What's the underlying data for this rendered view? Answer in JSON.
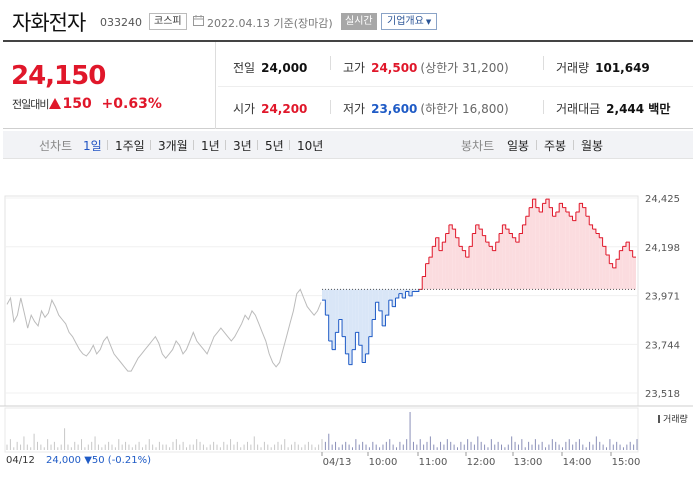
{
  "header": {
    "stock_name": "자화전자",
    "stock_code": "033240",
    "market": "코스피",
    "date": "2022.04.13  기준(장마감)",
    "realtime_label": "실시간",
    "company_label": "기업개요"
  },
  "summary": {
    "current_price": "24,150",
    "change_label": "전일대비",
    "change_value": "150",
    "change_pct": "+0.63%",
    "prev_close": {
      "label": "전일",
      "value": "24,000"
    },
    "high": {
      "label": "고가",
      "value": "24,500",
      "sub": "(상한가 31,200)"
    },
    "volume": {
      "label": "거래량",
      "value": "101,649"
    },
    "open": {
      "label": "시가",
      "value": "24,200"
    },
    "low": {
      "label": "저가",
      "value": "23,600",
      "sub": "(하한가 16,800)"
    },
    "amount": {
      "label": "거래대금",
      "value": "2,444 백만"
    }
  },
  "toolbar": {
    "line_label": "선차트",
    "line_periods": [
      "1일",
      "1주일",
      "3개월",
      "1년",
      "3년",
      "5년",
      "10년"
    ],
    "active_period": "1일",
    "candle_label": "봉차트",
    "candle_periods": [
      "일봉",
      "주봉",
      "월봉"
    ]
  },
  "chart_data": {
    "type": "line",
    "y_ticks": [
      "24,425",
      "24,198",
      "23,971",
      "23,744",
      "23,518"
    ],
    "ylim": [
      23518,
      24425
    ],
    "reference_price": 24000,
    "x_ticks": [
      "04/13",
      "10:00",
      "11:00",
      "12:00",
      "13:00",
      "14:00",
      "15:00"
    ],
    "prev_day_tick": "04/12",
    "volume_label": "거래량",
    "colors": {
      "up": "#e0172a",
      "down": "#1f5bc6",
      "prev": "#bbbbbb",
      "up_fill": "#fbdcdf",
      "down_fill": "#d9e6f7"
    },
    "prev_day_series": [
      23930,
      23960,
      23850,
      23880,
      23960,
      23890,
      23820,
      23880,
      23850,
      23830,
      23900,
      23870,
      23890,
      23950,
      23920,
      23880,
      23860,
      23840,
      23800,
      23780,
      23750,
      23720,
      23700,
      23690,
      23710,
      23740,
      23700,
      23720,
      23760,
      23780,
      23740,
      23700,
      23680,
      23660,
      23640,
      23620,
      23620,
      23650,
      23680,
      23700,
      23720,
      23740,
      23760,
      23780,
      23750,
      23700,
      23680,
      23700,
      23720,
      23760,
      23740,
      23700,
      23720,
      23760,
      23800,
      23760,
      23740,
      23720,
      23700,
      23740,
      23780,
      23800,
      23820,
      23800,
      23780,
      23760,
      23780,
      23810,
      23840,
      23880,
      23860,
      23900,
      23880,
      23840,
      23800,
      23760,
      23700,
      23660,
      23640,
      23660,
      23720,
      23780,
      23840,
      23900,
      23980,
      24000,
      23960,
      23920,
      23900,
      23880,
      23900,
      23940
    ],
    "today_series": [
      23950,
      23880,
      23760,
      23720,
      23800,
      23860,
      23780,
      23700,
      23650,
      23720,
      23800,
      23740,
      23660,
      23700,
      23780,
      23860,
      23940,
      23900,
      23830,
      23880,
      23950,
      23920,
      23960,
      23980,
      23960,
      23990,
      23970,
      23990,
      23990,
      24000,
      24060,
      24120,
      24150,
      24200,
      24240,
      24180,
      24220,
      24260,
      24300,
      24280,
      24240,
      24200,
      24180,
      24150,
      24200,
      24260,
      24300,
      24280,
      24250,
      24220,
      24200,
      24180,
      24220,
      24260,
      24300,
      24280,
      24260,
      24240,
      24220,
      24260,
      24300,
      24340,
      24380,
      24420,
      24380,
      24360,
      24400,
      24420,
      24380,
      24340,
      24360,
      24400,
      24380,
      24360,
      24340,
      24320,
      24360,
      24400,
      24380,
      24340,
      24300,
      24280,
      24260,
      24240,
      24200,
      24160,
      24120,
      24100,
      24140,
      24180,
      24200,
      24220,
      24180,
      24150,
      24150
    ],
    "volume_series": [
      2,
      4,
      1,
      3,
      2,
      5,
      2,
      1,
      6,
      3,
      2,
      1,
      4,
      2,
      3,
      1,
      2,
      8,
      2,
      1,
      3,
      2,
      4,
      1,
      2,
      3,
      5,
      2,
      1,
      2,
      3,
      2,
      1,
      4,
      2,
      3,
      2,
      1,
      2,
      3,
      1,
      2,
      4,
      2,
      1,
      3,
      2,
      2,
      1,
      3,
      4,
      2,
      3,
      1,
      2,
      2,
      4,
      3,
      2,
      1,
      2,
      3,
      2,
      1,
      3,
      2,
      4,
      2,
      3,
      1,
      2,
      3,
      2,
      5,
      2,
      1,
      3,
      2,
      1,
      2,
      3,
      2,
      4,
      1,
      2,
      3,
      2,
      1,
      2,
      3,
      2,
      1,
      2,
      4,
      3,
      6,
      2,
      3,
      1,
      2,
      3,
      2,
      1,
      4,
      2,
      3,
      2,
      1,
      3,
      2,
      1,
      2,
      3,
      4,
      2,
      1,
      3,
      2,
      4,
      14,
      3,
      2,
      4,
      2,
      3,
      5,
      2,
      1,
      3,
      2,
      4,
      3,
      2,
      1,
      3,
      2,
      4,
      3,
      2,
      5,
      3,
      2,
      1,
      4,
      2,
      3,
      2,
      1,
      2,
      5,
      3,
      2,
      4,
      1,
      3,
      2,
      4,
      2,
      3,
      1,
      2,
      4,
      3,
      2,
      1,
      3,
      4,
      2,
      3,
      4,
      2,
      1,
      3,
      2,
      5,
      3,
      2,
      1,
      4,
      2,
      3,
      2,
      1,
      2,
      3,
      2,
      4
    ]
  }
}
